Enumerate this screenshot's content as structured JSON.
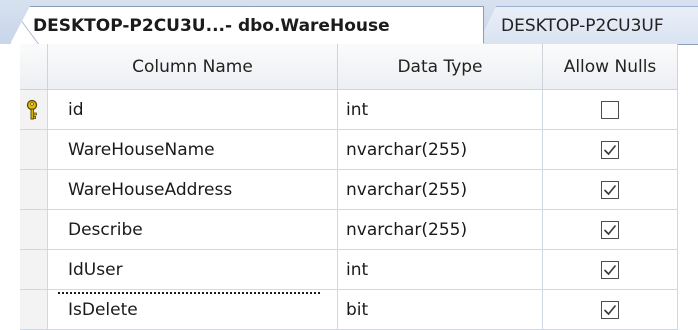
{
  "tabs": [
    {
      "label": "DESKTOP-P2CU3U...- dbo.WareHouse",
      "active": true
    },
    {
      "label": "DESKTOP-P2CU3UF",
      "active": false
    }
  ],
  "columns": {
    "name": "Column Name",
    "type": "Data Type",
    "nulls": "Allow Nulls"
  },
  "rows": [
    {
      "name": "id",
      "type": "int",
      "allow_nulls": false,
      "primary_key": true
    },
    {
      "name": "WareHouseName",
      "type": "nvarchar(255)",
      "allow_nulls": true
    },
    {
      "name": "WareHouseAddress",
      "type": "nvarchar(255)",
      "allow_nulls": true
    },
    {
      "name": "Describe",
      "type": "nvarchar(255)",
      "allow_nulls": true
    },
    {
      "name": "IdUser",
      "type": "int",
      "allow_nulls": true
    },
    {
      "name": "IsDelete",
      "type": "bit",
      "allow_nulls": true
    }
  ],
  "icons": {
    "primary_key": "key-icon",
    "checked": "checkmark-icon"
  },
  "colors": {
    "tab_border": "#8c9dba",
    "grid_line": "#d0d7e5",
    "key_fill": "#e8c000"
  }
}
